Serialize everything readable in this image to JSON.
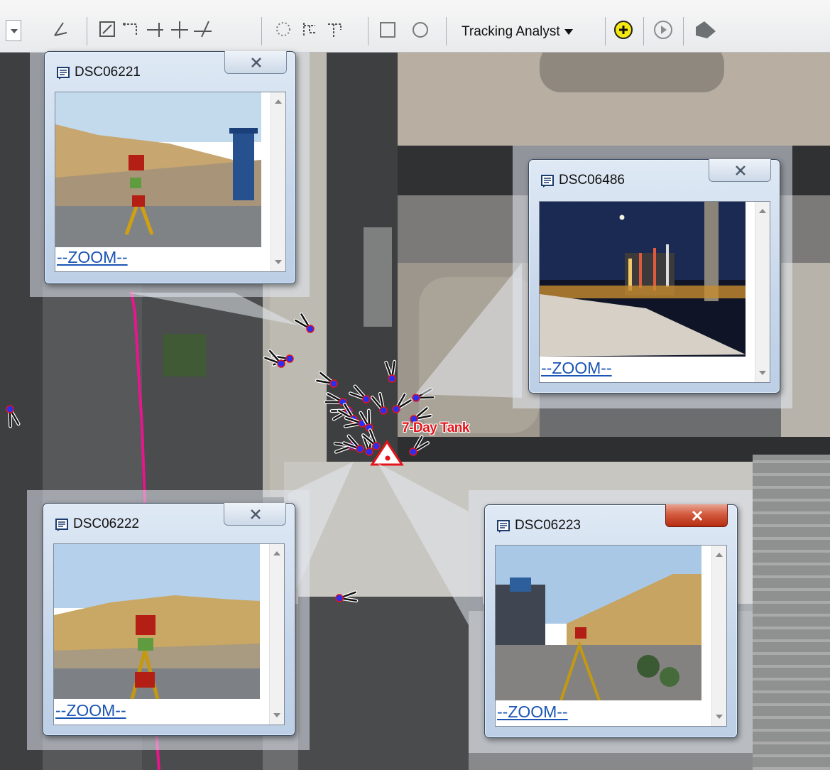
{
  "toolbar": {
    "tracking_analyst_label": "Tracking Analyst",
    "icons": [
      "dropdown-arrow-icon",
      "select-features-icon",
      "edit-vertex-icon",
      "reshape-icon",
      "split-line-icon",
      "add-point-icon",
      "measure-angle-icon",
      "cluster-icon",
      "trace-icon",
      "trace-segments-icon",
      "rectangle-icon",
      "circle-icon",
      "add-data-icon",
      "playback-icon",
      "tag-icon"
    ]
  },
  "map": {
    "feature_label": "7-Day Tank",
    "track_line_color": "#e8168c",
    "marker_color": "#2a2ef0",
    "label_color": "#e3141b"
  },
  "popups": [
    {
      "title": "DSC06221",
      "link": "--ZOOM--",
      "close_state": "inactive"
    },
    {
      "title": "DSC06486",
      "link": "--ZOOM--",
      "close_state": "inactive"
    },
    {
      "title": "DSC06222",
      "link": "--ZOOM--",
      "close_state": "inactive"
    },
    {
      "title": "DSC06223",
      "link": "--ZOOM--",
      "close_state": "active"
    }
  ]
}
